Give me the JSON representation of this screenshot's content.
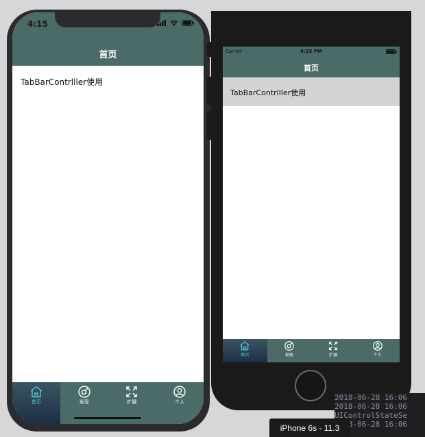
{
  "iphone_x": {
    "status_time": "4:15",
    "nav_title": "首页",
    "content_text": "TabBarContrlller使用",
    "tabs": [
      {
        "label": "首页",
        "icon": "home-icon",
        "selected": true
      },
      {
        "label": "发现",
        "icon": "discover-icon",
        "selected": false
      },
      {
        "label": "扩展",
        "icon": "expand-icon",
        "selected": false
      },
      {
        "label": "个人",
        "icon": "profile-icon",
        "selected": false
      }
    ]
  },
  "iphone_6s": {
    "carrier": "Carrier",
    "status_time": "4:15 PM",
    "nav_title": "首页",
    "cell_text": "TabBarContrlller使用",
    "tabs": [
      {
        "label": "首页",
        "icon": "home-icon",
        "selected": true
      },
      {
        "label": "发现",
        "icon": "discover-icon",
        "selected": false
      },
      {
        "label": "扩展",
        "icon": "expand-icon",
        "selected": false
      },
      {
        "label": "个人",
        "icon": "profile-icon",
        "selected": false
      }
    ]
  },
  "console_lines": [
    "2018-06-28 16:06",
    "2018-06-28 16:06",
    "UIControlStateSe",
    "2018-06-28 16:06"
  ],
  "device_tooltip": "iPhone 6s - 11.3",
  "colors": {
    "nav_bar": "#4a6b68",
    "tab_selected": "#4fd1d9",
    "cell_bg": "#d4d4d4"
  }
}
